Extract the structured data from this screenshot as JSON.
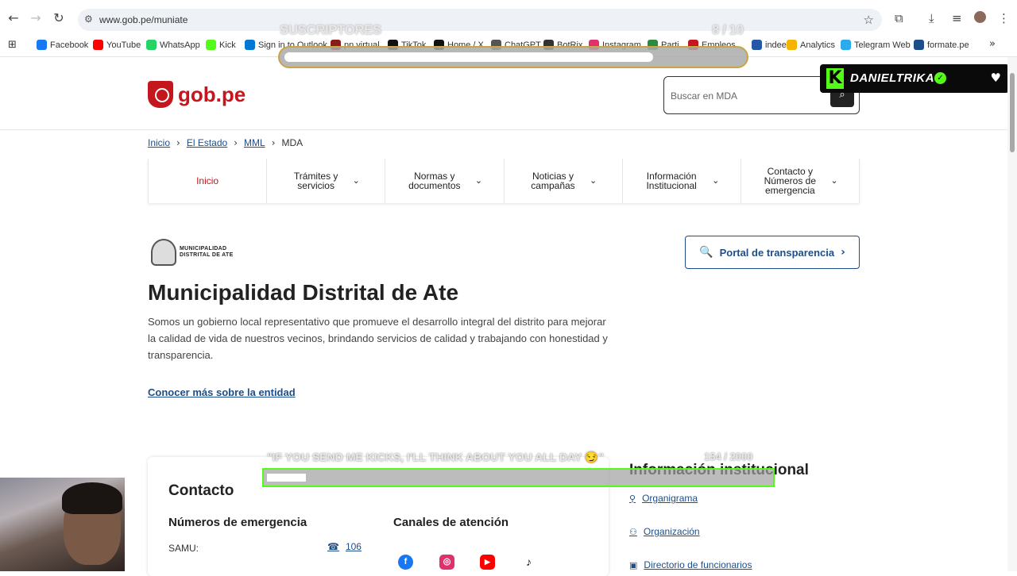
{
  "browser": {
    "url": "www.gob.pe/muniate",
    "bookmarks": [
      "Facebook",
      "YouTube",
      "WhatsApp",
      "Kick",
      "Sign in to Outlook",
      "pn virtual",
      "TikTok",
      "Home / X",
      "ChatGPT",
      "BotRix",
      "Instagram",
      "Parti",
      "Empleos",
      "indeed",
      "Analytics",
      "Telegram Web",
      "formate.pe"
    ],
    "bookmark_colors": [
      "#1877f2",
      "#ff0000",
      "#25d366",
      "#53fc18",
      "#0078d4",
      "#8b1a1a",
      "#111111",
      "#111111",
      "#555555",
      "#333333",
      "#e1306c",
      "#2b8a3e",
      "#c4161c",
      "#2557a7",
      "#f4b400",
      "#2aabee",
      "#1d4e89"
    ]
  },
  "overlay_subs": {
    "label": "SUSCRIPTORES",
    "count": "8 / 10",
    "progress": 0.8
  },
  "kick_badge": {
    "name": "DANIELTRIKA"
  },
  "site": {
    "logo_text": "gob.pe",
    "search_placeholder": "Buscar en MDA",
    "breadcrumb": [
      "Inicio",
      "El Estado",
      "MML",
      "MDA"
    ],
    "menu": [
      "Inicio",
      "Trámites y servicios",
      "Normas y documentos",
      "Noticias y campañas",
      "Información Institucional",
      "Contacto y Números de emergencia"
    ],
    "entity_logo_text": "MUNICIPALIDAD DISTRITAL DE ATE",
    "portal_button": "Portal de transparencia",
    "title": "Municipalidad Distrital de Ate",
    "description": "Somos un gobierno local representativo que promueve el desarrollo integral del distrito para mejorar la calidad de vida de nuestros vecinos, brindando servicios de calidad y trabajando con honestidad y transparencia.",
    "more_link": "Conocer más sobre la entidad",
    "contact": {
      "heading": "Contacto",
      "emergency_heading": "Números de emergencia",
      "channels_heading": "Canales de atención",
      "samu_label": "SAMU:",
      "samu_number": "106"
    },
    "info": {
      "heading": "Información institucional",
      "links": [
        "Organigrama",
        "Organización",
        "Directorio de funcionarios"
      ]
    }
  },
  "overlay_kicks": {
    "message": "\"IF YOU SEND ME KICKS, I'LL THINK ABOUT YOU ALL DAY 😏\"",
    "count": "154 / 2000",
    "progress": 0.077
  },
  "colors": {
    "accent_red": "#c4161c",
    "link_blue": "#1d4e89",
    "kick_green": "#53fc18"
  }
}
